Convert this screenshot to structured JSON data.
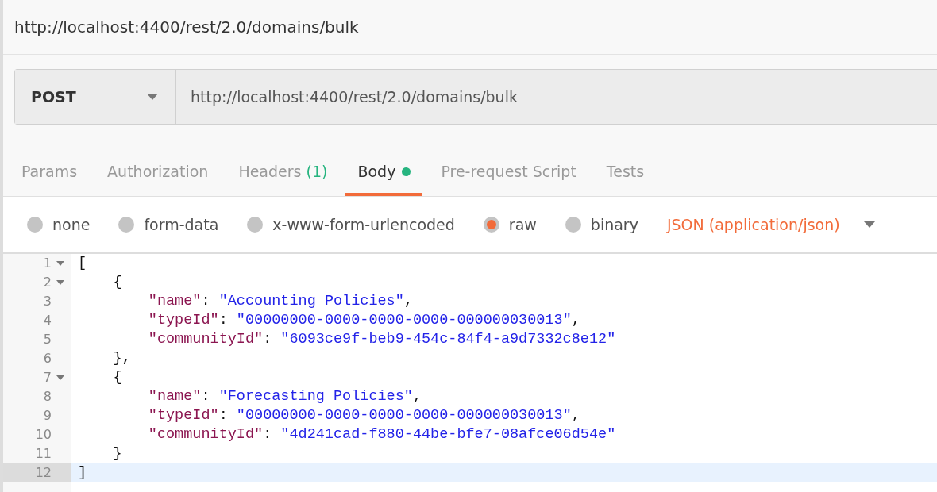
{
  "title": "http://localhost:4400/rest/2.0/domains/bulk",
  "request": {
    "method": "POST",
    "url": "http://localhost:4400/rest/2.0/domains/bulk"
  },
  "tabs": [
    {
      "label": "Params",
      "selected": false
    },
    {
      "label": "Authorization",
      "selected": false
    },
    {
      "label": "Headers",
      "count": "(1)",
      "selected": false
    },
    {
      "label": "Body",
      "dot": true,
      "selected": true
    },
    {
      "label": "Pre-request Script",
      "selected": false
    },
    {
      "label": "Tests",
      "selected": false
    }
  ],
  "body_types": [
    {
      "label": "none",
      "selected": false
    },
    {
      "label": "form-data",
      "selected": false
    },
    {
      "label": "x-www-form-urlencoded",
      "selected": false
    },
    {
      "label": "raw",
      "selected": true
    },
    {
      "label": "binary",
      "selected": false
    }
  ],
  "content_type": "JSON (application/json)",
  "editor_lines": [
    {
      "number": "1",
      "fold": true,
      "current": false,
      "tokens": [
        {
          "kind": "punct",
          "text": "["
        }
      ]
    },
    {
      "number": "2",
      "fold": true,
      "current": false,
      "tokens": [
        {
          "kind": "punct",
          "text": "    {"
        }
      ]
    },
    {
      "number": "3",
      "fold": false,
      "current": false,
      "tokens": [
        {
          "kind": "key",
          "text": "        \"name\""
        },
        {
          "kind": "punct",
          "text": ": "
        },
        {
          "kind": "string",
          "text": "\"Accounting Policies\""
        },
        {
          "kind": "punct",
          "text": ","
        }
      ]
    },
    {
      "number": "4",
      "fold": false,
      "current": false,
      "tokens": [
        {
          "kind": "key",
          "text": "        \"typeId\""
        },
        {
          "kind": "punct",
          "text": ": "
        },
        {
          "kind": "string",
          "text": "\"00000000-0000-0000-0000-000000030013\""
        },
        {
          "kind": "punct",
          "text": ","
        }
      ]
    },
    {
      "number": "5",
      "fold": false,
      "current": false,
      "tokens": [
        {
          "kind": "key",
          "text": "        \"communityId\""
        },
        {
          "kind": "punct",
          "text": ": "
        },
        {
          "kind": "string",
          "text": "\"6093ce9f-beb9-454c-84f4-a9d7332c8e12\""
        }
      ]
    },
    {
      "number": "6",
      "fold": false,
      "current": false,
      "tokens": [
        {
          "kind": "punct",
          "text": "    },"
        }
      ]
    },
    {
      "number": "7",
      "fold": true,
      "current": false,
      "tokens": [
        {
          "kind": "punct",
          "text": "    {"
        }
      ]
    },
    {
      "number": "8",
      "fold": false,
      "current": false,
      "tokens": [
        {
          "kind": "key",
          "text": "        \"name\""
        },
        {
          "kind": "punct",
          "text": ": "
        },
        {
          "kind": "string",
          "text": "\"Forecasting Policies\""
        },
        {
          "kind": "punct",
          "text": ","
        }
      ]
    },
    {
      "number": "9",
      "fold": false,
      "current": false,
      "tokens": [
        {
          "kind": "key",
          "text": "        \"typeId\""
        },
        {
          "kind": "punct",
          "text": ": "
        },
        {
          "kind": "string",
          "text": "\"00000000-0000-0000-0000-000000030013\""
        },
        {
          "kind": "punct",
          "text": ","
        }
      ]
    },
    {
      "number": "10",
      "fold": false,
      "current": false,
      "tokens": [
        {
          "kind": "key",
          "text": "        \"communityId\""
        },
        {
          "kind": "punct",
          "text": ": "
        },
        {
          "kind": "string",
          "text": "\"4d241cad-f880-44be-bfe7-08afce06d54e\""
        }
      ]
    },
    {
      "number": "11",
      "fold": false,
      "current": false,
      "tokens": [
        {
          "kind": "punct",
          "text": "    }"
        }
      ]
    },
    {
      "number": "12",
      "fold": false,
      "current": true,
      "tokens": [
        {
          "kind": "punct",
          "text": "]"
        }
      ]
    }
  ]
}
